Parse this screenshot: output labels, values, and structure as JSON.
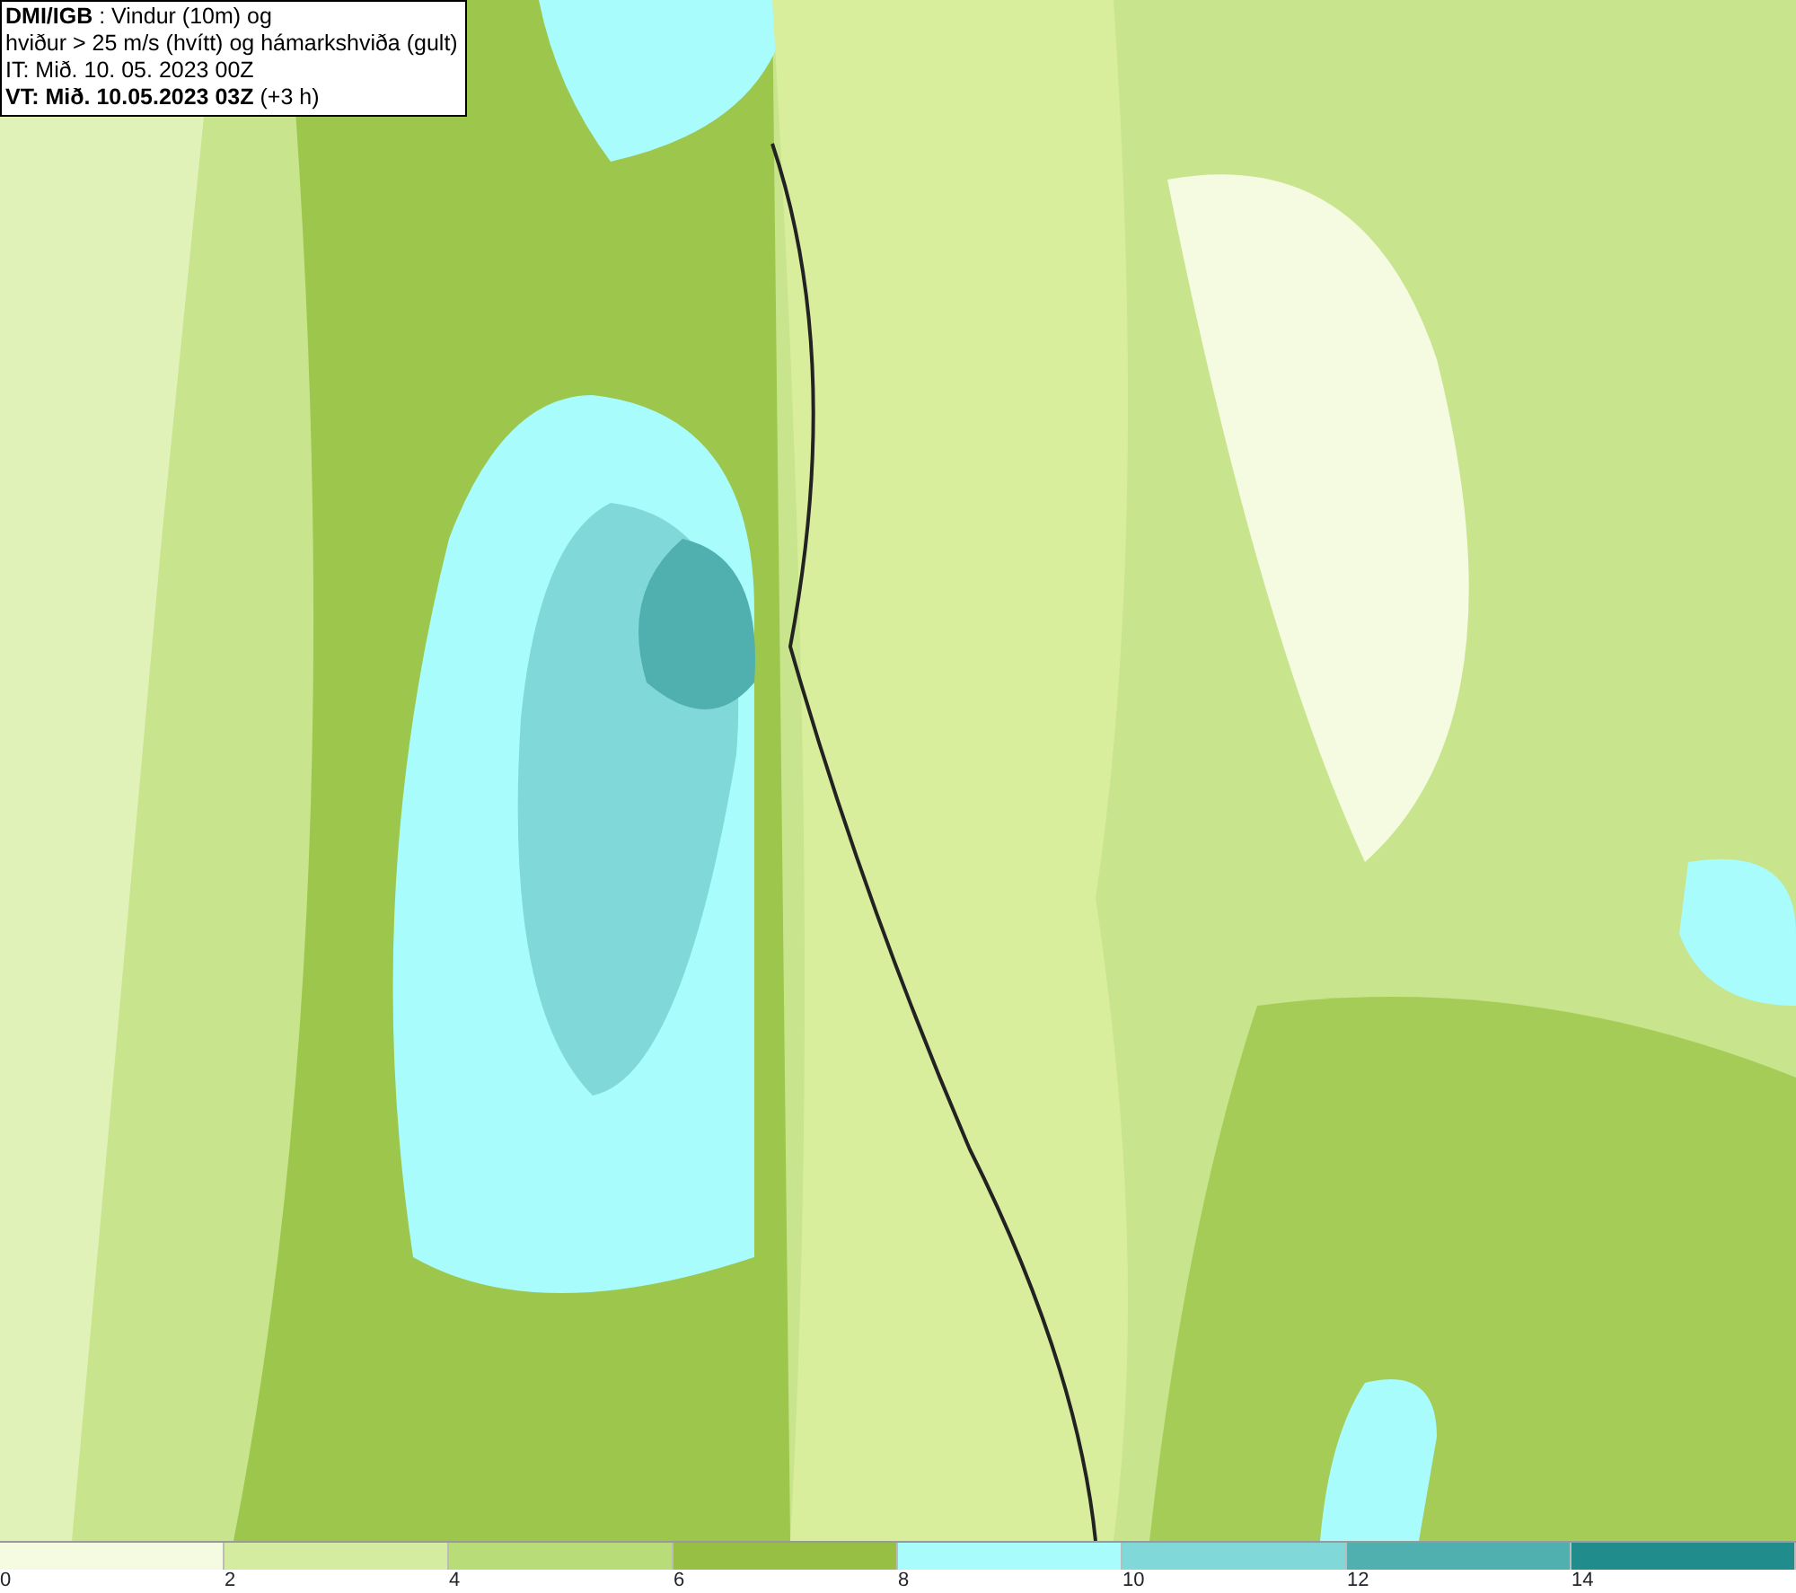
{
  "info_box": {
    "lines": [
      "**DMI/IGB** : Vindur (10m) og",
      "hviður > 25 m/s (hvítt) og hámarkshviða (gult)",
      "IT: Mið. 10. 05. 2023 00Z",
      "**VT: Mið. 10.05.2023 03Z** (+3 h)"
    ]
  },
  "legend": {
    "bins": [
      {
        "label": "0",
        "color": "#f4fbe0"
      },
      {
        "label": "2",
        "color": "#d4eca0"
      },
      {
        "label": "4",
        "color": "#b8dc78"
      },
      {
        "label": "6",
        "color": "#96bf44"
      },
      {
        "label": "8",
        "color": "#a8fcfc"
      },
      {
        "label": "10",
        "color": "#80d8d8"
      },
      {
        "label": "12",
        "color": "#50b0b0"
      },
      {
        "label": "14",
        "color": "#208c8c"
      }
    ]
  }
}
